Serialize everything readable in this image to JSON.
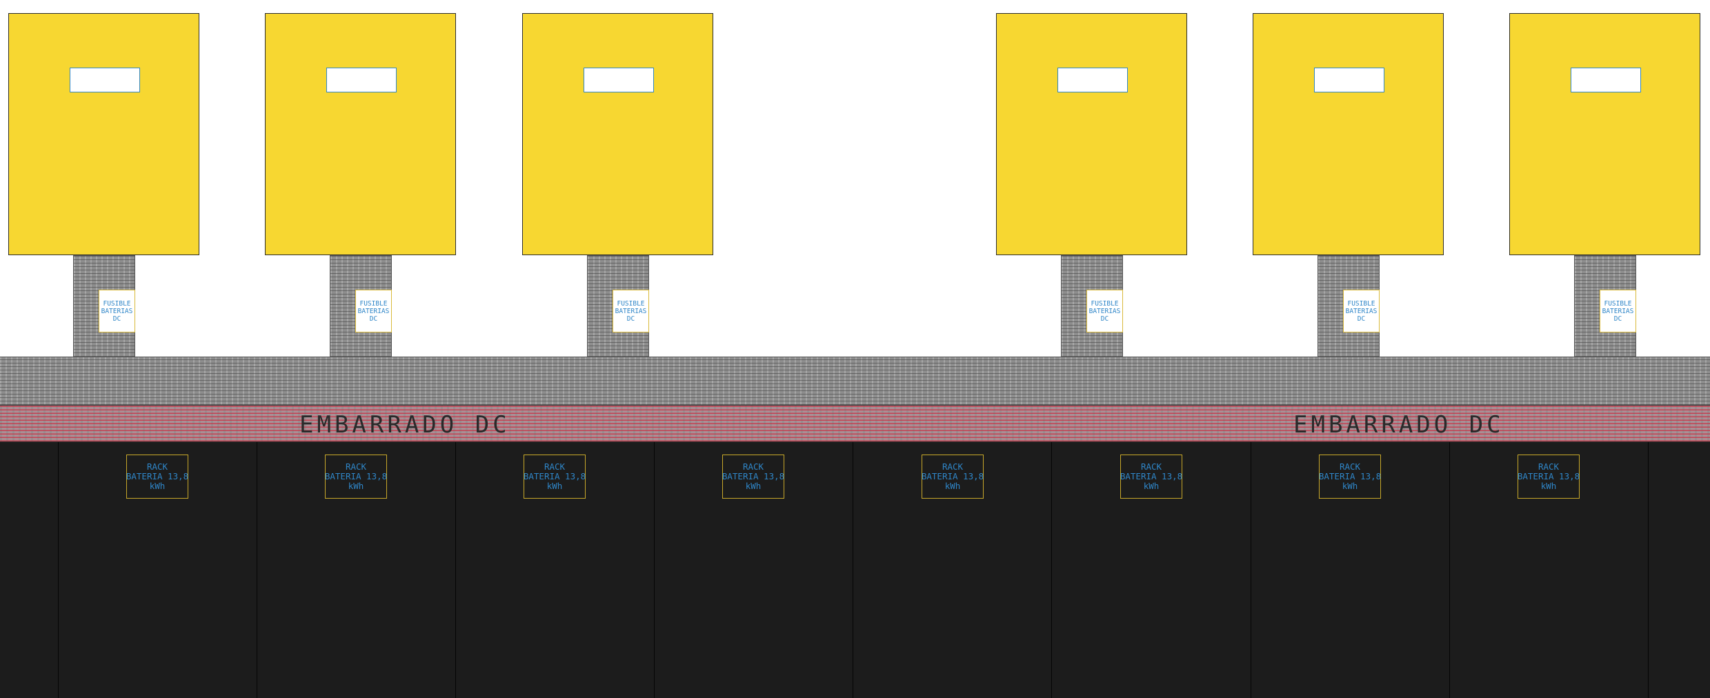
{
  "colors": {
    "inverter_fill": "#f7d731",
    "display_stroke": "#2f86c8",
    "label_text": "#2f86c8",
    "gray_busbar": "#8e8e8e",
    "red_busbar_hatch": "#cd283c",
    "battery_zone": "#1c1c1c",
    "rack_outline": "#c9a92a"
  },
  "inverters": [
    {
      "id": "inv-1",
      "fuse": {
        "line1": "FUSIBLE",
        "line2": "BATERIAS",
        "line3": "DC"
      }
    },
    {
      "id": "inv-2",
      "fuse": {
        "line1": "FUSIBLE",
        "line2": "BATERIAS",
        "line3": "DC"
      }
    },
    {
      "id": "inv-3",
      "fuse": {
        "line1": "FUSIBLE",
        "line2": "BATERIAS",
        "line3": "DC"
      }
    },
    {
      "id": "inv-4",
      "fuse": {
        "line1": "FUSIBLE",
        "line2": "BATERIAS",
        "line3": "DC"
      }
    },
    {
      "id": "inv-5",
      "fuse": {
        "line1": "FUSIBLE",
        "line2": "BATERIAS",
        "line3": "DC"
      }
    },
    {
      "id": "inv-6",
      "fuse": {
        "line1": "FUSIBLE",
        "line2": "BATERIAS",
        "line3": "DC"
      }
    }
  ],
  "busbar": {
    "label_left": "EMBARRADO DC",
    "label_right": "EMBARRADO DC"
  },
  "racks": [
    {
      "line1": "RACK",
      "line2": "BATERIA 13,8",
      "line3": "kWh"
    },
    {
      "line1": "RACK",
      "line2": "BATERIA 13,8",
      "line3": "kWh"
    },
    {
      "line1": "RACK",
      "line2": "BATERIA 13,8",
      "line3": "kWh"
    },
    {
      "line1": "RACK",
      "line2": "BATERIA 13,8",
      "line3": "kWh"
    },
    {
      "line1": "RACK",
      "line2": "BATERIA 13,8",
      "line3": "kWh"
    },
    {
      "line1": "RACK",
      "line2": "BATERIA 13,8",
      "line3": "kWh"
    },
    {
      "line1": "RACK",
      "line2": "BATERIA 13,8",
      "line3": "kWh"
    },
    {
      "line1": "RACK",
      "line2": "BATERIA 13,8",
      "line3": "kWh"
    }
  ]
}
